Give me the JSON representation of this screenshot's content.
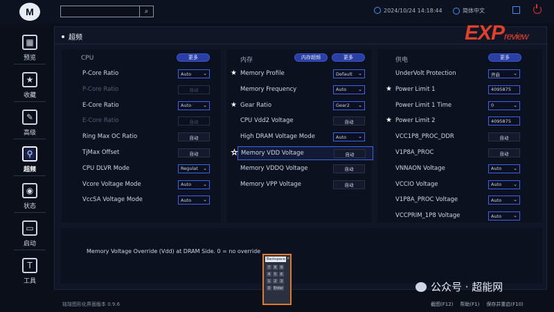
{
  "topbar": {
    "logo_glyph": "M",
    "search_placeholder": "",
    "search_glyph": "⌕",
    "datetime": "2024/10/24 14:18:44",
    "language": "简体中文"
  },
  "sidebar": {
    "items": [
      {
        "label": "预览",
        "icon": "grid-icon",
        "glyph": "▦",
        "active": false
      },
      {
        "label": "收藏",
        "icon": "star-icon",
        "glyph": "★",
        "active": false
      },
      {
        "label": "高级",
        "icon": "wrench-icon",
        "glyph": "✎",
        "active": false
      },
      {
        "label": "超频",
        "icon": "rocket-icon",
        "glyph": "⚲",
        "active": true
      },
      {
        "label": "状态",
        "icon": "gauge-icon",
        "glyph": "◉",
        "active": false
      },
      {
        "label": "启动",
        "icon": "boot-icon",
        "glyph": "▭",
        "active": false
      },
      {
        "label": "工具",
        "icon": "tool-icon",
        "glyph": "T",
        "active": false
      }
    ]
  },
  "page": {
    "title": "超频",
    "brand": "EXP",
    "brand_suffix": "review"
  },
  "cpu": {
    "title": "CPU",
    "more": "更多",
    "rows": [
      {
        "name": "P-Core Ratio",
        "value": "Auto",
        "type": "select",
        "dim": false
      },
      {
        "name": "P-Core Ratio",
        "value": "自动",
        "type": "disabled",
        "dim": true
      },
      {
        "name": "E-Core Ratio",
        "value": "Auto",
        "type": "select",
        "dim": false
      },
      {
        "name": "E-Core Ratio",
        "value": "自动",
        "type": "disabled",
        "dim": true
      },
      {
        "name": "Ring Max OC Ratio",
        "value": "自动",
        "type": "button",
        "dim": false
      },
      {
        "name": "TjMax Offset",
        "value": "自动",
        "type": "button",
        "dim": false
      },
      {
        "name": "CPU DLVR Mode",
        "value": "Regulat",
        "type": "select",
        "dim": false
      },
      {
        "name": "Vcore Voltage Mode",
        "value": "Auto",
        "type": "select",
        "dim": false
      },
      {
        "name": "VccSA Voltage Mode",
        "value": "Auto",
        "type": "select",
        "dim": false
      }
    ]
  },
  "memory": {
    "title": "内存",
    "aux": "内存超频",
    "more": "更多",
    "rows": [
      {
        "name": "Memory Profile",
        "value": "Default",
        "type": "select",
        "star": "filled"
      },
      {
        "name": "Memory Frequency",
        "value": "Auto",
        "type": "select",
        "star": ""
      },
      {
        "name": "Gear Ratio",
        "value": "Gear2",
        "type": "select",
        "star": "filled"
      },
      {
        "name": "CPU Vdd2 Voltage",
        "value": "自动",
        "type": "button",
        "star": ""
      },
      {
        "name": "High DRAM Voltage Mode",
        "value": "Auto",
        "type": "select",
        "star": ""
      },
      {
        "name": "Memory VDD Voltage",
        "value": "自动",
        "type": "button",
        "star": "outline",
        "highlight": true
      },
      {
        "name": "Memory VDDQ Voltage",
        "value": "自动",
        "type": "button",
        "star": ""
      },
      {
        "name": "Memory VPP Voltage",
        "value": "自动",
        "type": "button",
        "star": ""
      }
    ]
  },
  "power": {
    "title": "供电",
    "more": "更多",
    "rows": [
      {
        "name": "UnderVolt Protection",
        "value": "开启",
        "type": "select",
        "star": ""
      },
      {
        "name": "Power Limit 1",
        "value": "4095875",
        "type": "input",
        "star": "filled"
      },
      {
        "name": "Power Limit 1 Time",
        "value": "0",
        "type": "select",
        "star": ""
      },
      {
        "name": "Power Limit 2",
        "value": "4095875",
        "type": "input",
        "star": "filled"
      },
      {
        "name": "VCC1P8_PROC_DDR",
        "value": "自动",
        "type": "button",
        "star": ""
      },
      {
        "name": "V1P8A_PROC",
        "value": "自动",
        "type": "button",
        "star": ""
      },
      {
        "name": "VNNAON Voltage",
        "value": "Auto",
        "type": "select",
        "star": ""
      },
      {
        "name": "VCCIO Voltage",
        "value": "Auto",
        "type": "select",
        "star": ""
      },
      {
        "name": "V1P8A_PROC Voltage",
        "value": "Auto",
        "type": "select",
        "star": ""
      },
      {
        "name": "VCCPRIM_1P8 Voltage",
        "value": "Auto",
        "type": "select",
        "star": ""
      }
    ]
  },
  "description": "Memory Voltage Override (Vdd) at DRAM Side. 0 = no override",
  "keypad": {
    "display": "Backspace",
    "close": "×",
    "keys": [
      "7",
      "8",
      "9",
      "4",
      "5",
      "6",
      "1",
      "2",
      "3",
      "0",
      "Enter"
    ]
  },
  "footer": {
    "version": "铭瑄图形化界面版本 0.9.6",
    "screenshot": "截图(F12)",
    "help": "帮助(F1)",
    "save_reset": "保存并重启(F10)"
  },
  "watermark": "公众号 · 超能网",
  "colors": {
    "accent": "#3e63e6",
    "brand": "#e0412d",
    "keypad_border": "#e07a2a"
  }
}
